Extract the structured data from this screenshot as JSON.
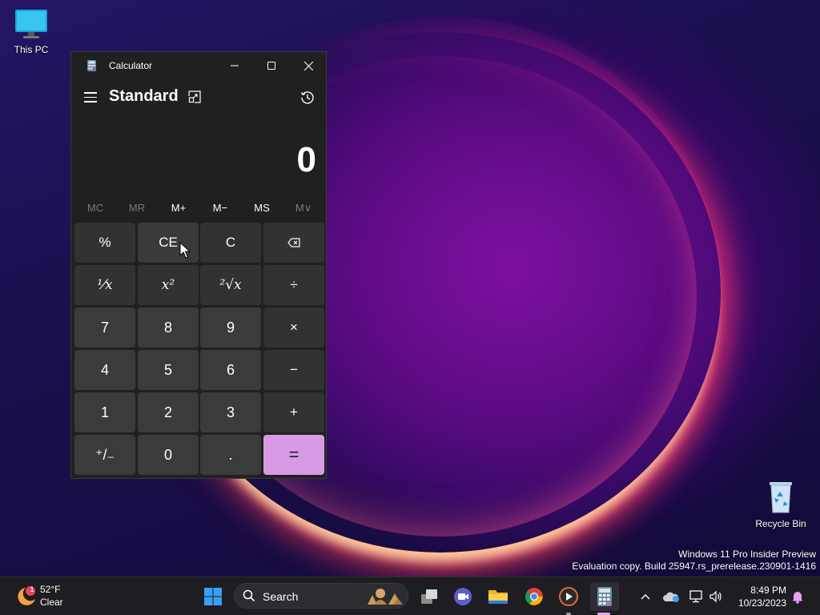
{
  "desktop": {
    "icons": [
      {
        "label": "This PC"
      },
      {
        "label": "Recycle Bin"
      }
    ],
    "watermark": {
      "line1": "Windows 11 Pro Insider Preview",
      "line2": "Evaluation copy. Build 25947.rs_prerelease.230901-1416"
    }
  },
  "calculator": {
    "window_title": "Calculator",
    "mode": "Standard",
    "display": "0",
    "memory_buttons": [
      {
        "label": "MC",
        "enabled": false
      },
      {
        "label": "MR",
        "enabled": false
      },
      {
        "label": "M+",
        "enabled": true
      },
      {
        "label": "M−",
        "enabled": true
      },
      {
        "label": "MS",
        "enabled": true
      },
      {
        "label": "M∨",
        "enabled": false
      }
    ],
    "keys": {
      "percent": "%",
      "ce": "CE",
      "c": "C",
      "reciprocal": "¹⁄x",
      "square": "x²",
      "sqrt": "²√x",
      "divide": "÷",
      "seven": "7",
      "eight": "8",
      "nine": "9",
      "multiply": "×",
      "four": "4",
      "five": "5",
      "six": "6",
      "minus": "−",
      "one": "1",
      "two": "2",
      "three": "3",
      "plus": "+",
      "negate": "⁺/₋",
      "zero": "0",
      "decimal": ".",
      "equals": "="
    },
    "accent_color": "#d89be3"
  },
  "taskbar": {
    "weather": {
      "temp": "52°F",
      "condition": "Clear",
      "badge": "1"
    },
    "search_placeholder": "Search",
    "clock": {
      "time": "8:49 PM",
      "date": "10/23/2023"
    },
    "pinned": [
      "start-icon",
      "search-icon",
      "task-view-icon",
      "meet-icon",
      "file-explorer-icon",
      "chrome-icon",
      "media-player-icon",
      "calculator-icon"
    ]
  }
}
